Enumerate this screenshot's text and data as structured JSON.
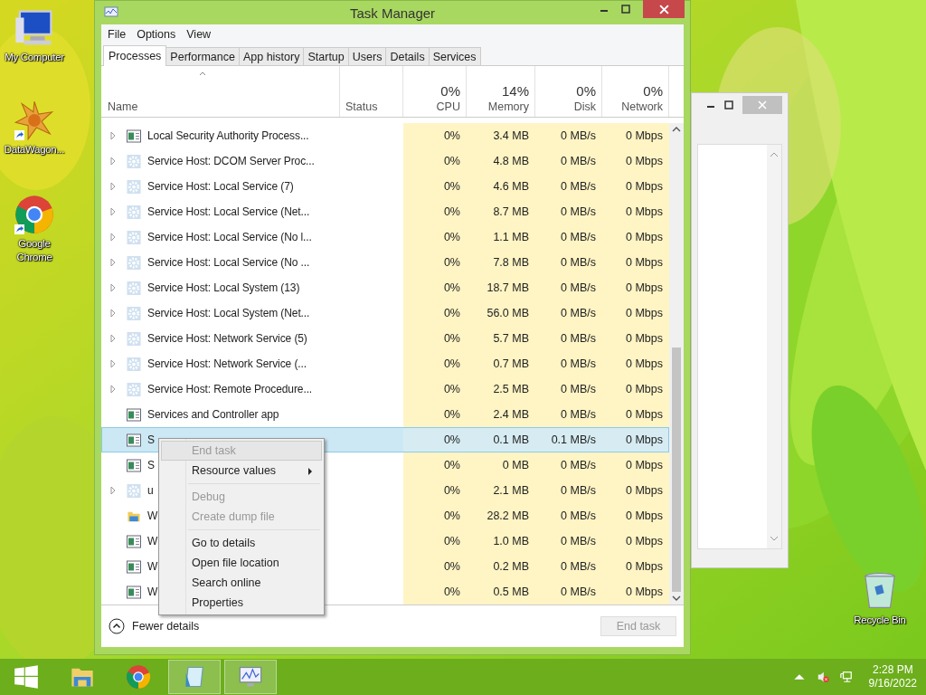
{
  "desktop": {
    "kind": "picture",
    "icons": [
      {
        "kind": "computer",
        "label": "My Computer",
        "shortcut": false
      },
      {
        "kind": "star",
        "label": "DataWagon...",
        "shortcut": true
      },
      {
        "kind": "chrome",
        "label": "Google Chrome",
        "shortcut": true
      },
      {
        "kind": "bin",
        "label": "Recycle Bin",
        "shortcut": false
      }
    ]
  },
  "window": {
    "title": "Task Manager",
    "menu": [
      "File",
      "Options",
      "View"
    ],
    "tabs": [
      {
        "label": "Processes",
        "selected": true
      },
      {
        "label": "Performance",
        "selected": false
      },
      {
        "label": "App history",
        "selected": false
      },
      {
        "label": "Startup",
        "selected": false
      },
      {
        "label": "Users",
        "selected": false
      },
      {
        "label": "Details",
        "selected": false
      },
      {
        "label": "Services",
        "selected": false
      }
    ],
    "table": {
      "columns": [
        {
          "label": "Name"
        },
        {
          "label": "Status"
        },
        {
          "label": "CPU",
          "total": "0%"
        },
        {
          "label": "Memory",
          "total": "14%"
        },
        {
          "label": "Disk",
          "total": "0%"
        },
        {
          "label": "Network",
          "total": "0%"
        }
      ],
      "rows": [
        {
          "expandable": true,
          "kind": "app",
          "name": "Local Security Authority Process...",
          "cpu": "0%",
          "memory": "3.4 MB",
          "disk": "0 MB/s",
          "network": "0 Mbps",
          "selected": false
        },
        {
          "expandable": true,
          "kind": "gear",
          "name": "Service Host: DCOM Server Proc...",
          "cpu": "0%",
          "memory": "4.8 MB",
          "disk": "0 MB/s",
          "network": "0 Mbps",
          "selected": false
        },
        {
          "expandable": true,
          "kind": "gear",
          "name": "Service Host: Local Service (7)",
          "cpu": "0%",
          "memory": "4.6 MB",
          "disk": "0 MB/s",
          "network": "0 Mbps",
          "selected": false
        },
        {
          "expandable": true,
          "kind": "gear",
          "name": "Service Host: Local Service (Net...",
          "cpu": "0%",
          "memory": "8.7 MB",
          "disk": "0 MB/s",
          "network": "0 Mbps",
          "selected": false
        },
        {
          "expandable": true,
          "kind": "gear",
          "name": "Service Host: Local Service (No l...",
          "cpu": "0%",
          "memory": "1.1 MB",
          "disk": "0 MB/s",
          "network": "0 Mbps",
          "selected": false
        },
        {
          "expandable": true,
          "kind": "gear",
          "name": "Service Host: Local Service (No ...",
          "cpu": "0%",
          "memory": "7.8 MB",
          "disk": "0 MB/s",
          "network": "0 Mbps",
          "selected": false
        },
        {
          "expandable": true,
          "kind": "gear",
          "name": "Service Host: Local System (13)",
          "cpu": "0%",
          "memory": "18.7 MB",
          "disk": "0 MB/s",
          "network": "0 Mbps",
          "selected": false
        },
        {
          "expandable": true,
          "kind": "gear",
          "name": "Service Host: Local System (Net...",
          "cpu": "0%",
          "memory": "56.0 MB",
          "disk": "0 MB/s",
          "network": "0 Mbps",
          "selected": false
        },
        {
          "expandable": true,
          "kind": "gear",
          "name": "Service Host: Network Service (5)",
          "cpu": "0%",
          "memory": "5.7 MB",
          "disk": "0 MB/s",
          "network": "0 Mbps",
          "selected": false
        },
        {
          "expandable": true,
          "kind": "gear",
          "name": "Service Host: Network Service (...",
          "cpu": "0%",
          "memory": "0.7 MB",
          "disk": "0 MB/s",
          "network": "0 Mbps",
          "selected": false
        },
        {
          "expandable": true,
          "kind": "gear",
          "name": "Service Host: Remote Procedure...",
          "cpu": "0%",
          "memory": "2.5 MB",
          "disk": "0 MB/s",
          "network": "0 Mbps",
          "selected": false
        },
        {
          "expandable": false,
          "kind": "app",
          "name": "Services and Controller app",
          "cpu": "0%",
          "memory": "2.4 MB",
          "disk": "0 MB/s",
          "network": "0 Mbps",
          "selected": false
        },
        {
          "expandable": false,
          "kind": "app",
          "name": "S",
          "cpu": "0%",
          "memory": "0.1 MB",
          "disk": "0.1 MB/s",
          "network": "0 Mbps",
          "selected": true
        },
        {
          "expandable": false,
          "kind": "app",
          "name": "S",
          "cpu": "0%",
          "memory": "0 MB",
          "disk": "0 MB/s",
          "network": "0 Mbps",
          "selected": false
        },
        {
          "expandable": true,
          "kind": "gear",
          "name": "u",
          "cpu": "0%",
          "memory": "2.1 MB",
          "disk": "0 MB/s",
          "network": "0 Mbps",
          "selected": false
        },
        {
          "expandable": false,
          "kind": "folder",
          "name": "W",
          "cpu": "0%",
          "memory": "28.2 MB",
          "disk": "0 MB/s",
          "network": "0 Mbps",
          "selected": false
        },
        {
          "expandable": false,
          "kind": "app",
          "name": "W",
          "cpu": "0%",
          "memory": "1.0 MB",
          "disk": "0 MB/s",
          "network": "0 Mbps",
          "selected": false
        },
        {
          "expandable": false,
          "kind": "app",
          "name": "W",
          "cpu": "0%",
          "memory": "0.2 MB",
          "disk": "0 MB/s",
          "network": "0 Mbps",
          "selected": false
        },
        {
          "expandable": false,
          "kind": "app",
          "name": "W",
          "cpu": "0%",
          "memory": "0.5 MB",
          "disk": "0 MB/s",
          "network": "0 Mbps",
          "selected": false
        }
      ]
    },
    "footer": {
      "toggle": "Fewer details",
      "button": {
        "label": "End task",
        "disabled": true
      }
    }
  },
  "context_menu": {
    "groups": [
      [
        {
          "label": "End task",
          "disabled": true,
          "selected": true,
          "submenu": false
        },
        {
          "label": "Resource values",
          "disabled": false,
          "selected": false,
          "submenu": true
        }
      ],
      [
        {
          "label": "Debug",
          "disabled": true,
          "selected": false,
          "submenu": false
        },
        {
          "label": "Create dump file",
          "disabled": true,
          "selected": false,
          "submenu": false
        }
      ],
      [
        {
          "label": "Go to details",
          "disabled": false,
          "selected": false,
          "submenu": false
        },
        {
          "label": "Open file location",
          "disabled": false,
          "selected": false,
          "submenu": false
        },
        {
          "label": "Search online",
          "disabled": false,
          "selected": false,
          "submenu": false
        },
        {
          "label": "Properties",
          "disabled": false,
          "selected": false,
          "submenu": false
        }
      ]
    ]
  },
  "taskbar": {
    "items": [
      {
        "kind": "start",
        "running": false
      },
      {
        "kind": "explorer",
        "running": false
      },
      {
        "kind": "chrome",
        "running": false
      },
      {
        "kind": "notepad",
        "running": true
      },
      {
        "kind": "monitor",
        "running": true
      }
    ],
    "clock": {
      "time": "2:28 PM",
      "date": "9/16/2022"
    }
  }
}
